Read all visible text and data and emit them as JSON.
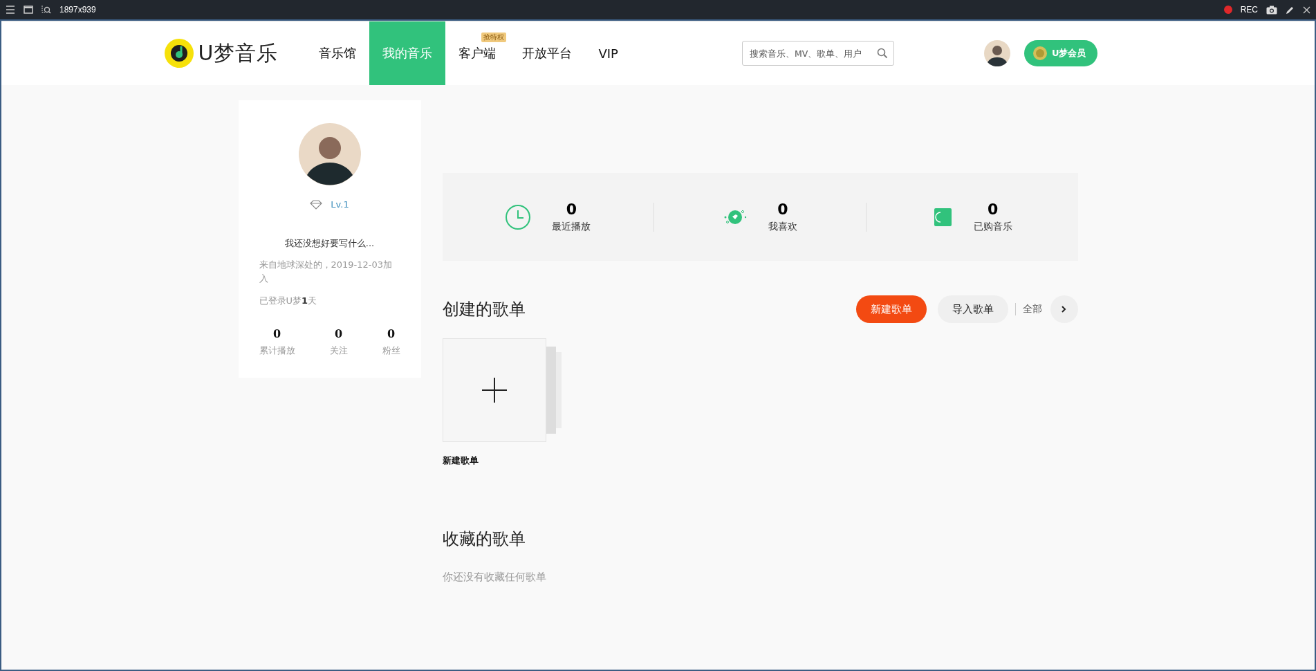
{
  "recorder": {
    "size": "1897x939",
    "rec": "REC"
  },
  "header": {
    "logo": "U梦音乐",
    "nav": [
      {
        "label": "音乐馆",
        "selected": false
      },
      {
        "label": "我的音乐",
        "selected": true
      },
      {
        "label": "客户端",
        "selected": false,
        "badge": "抢特权"
      },
      {
        "label": "开放平台",
        "selected": false
      },
      {
        "label": "VIP",
        "selected": false
      }
    ],
    "search": {
      "placeholder": "搜索音乐、MV、歌单、用户"
    },
    "vip_button": "U梦会员"
  },
  "profile": {
    "level": "Lv.1",
    "bio": "我还没想好要写什么...",
    "joined": "来自地球深处的，2019-12-03加入",
    "login": "已登录U梦**1**天",
    "stats": [
      {
        "value": "0",
        "label": "累计播放"
      },
      {
        "value": "0",
        "label": "关注"
      },
      {
        "value": "0",
        "label": "粉丝"
      }
    ]
  },
  "summary": [
    {
      "kind": "clock",
      "value": "0",
      "label": "最近播放"
    },
    {
      "kind": "heart",
      "value": "0",
      "label": "我喜欢"
    },
    {
      "kind": "book",
      "value": "0",
      "label": "已购音乐"
    }
  ],
  "created": {
    "title": "创建的歌单",
    "new_button": "新建歌单",
    "import_button": "导入歌单",
    "all_link": "全部",
    "cards": [
      {
        "label": "新建歌单"
      }
    ]
  },
  "collected": {
    "title": "收藏的歌单",
    "empty": "你还没有收藏任何歌单"
  }
}
